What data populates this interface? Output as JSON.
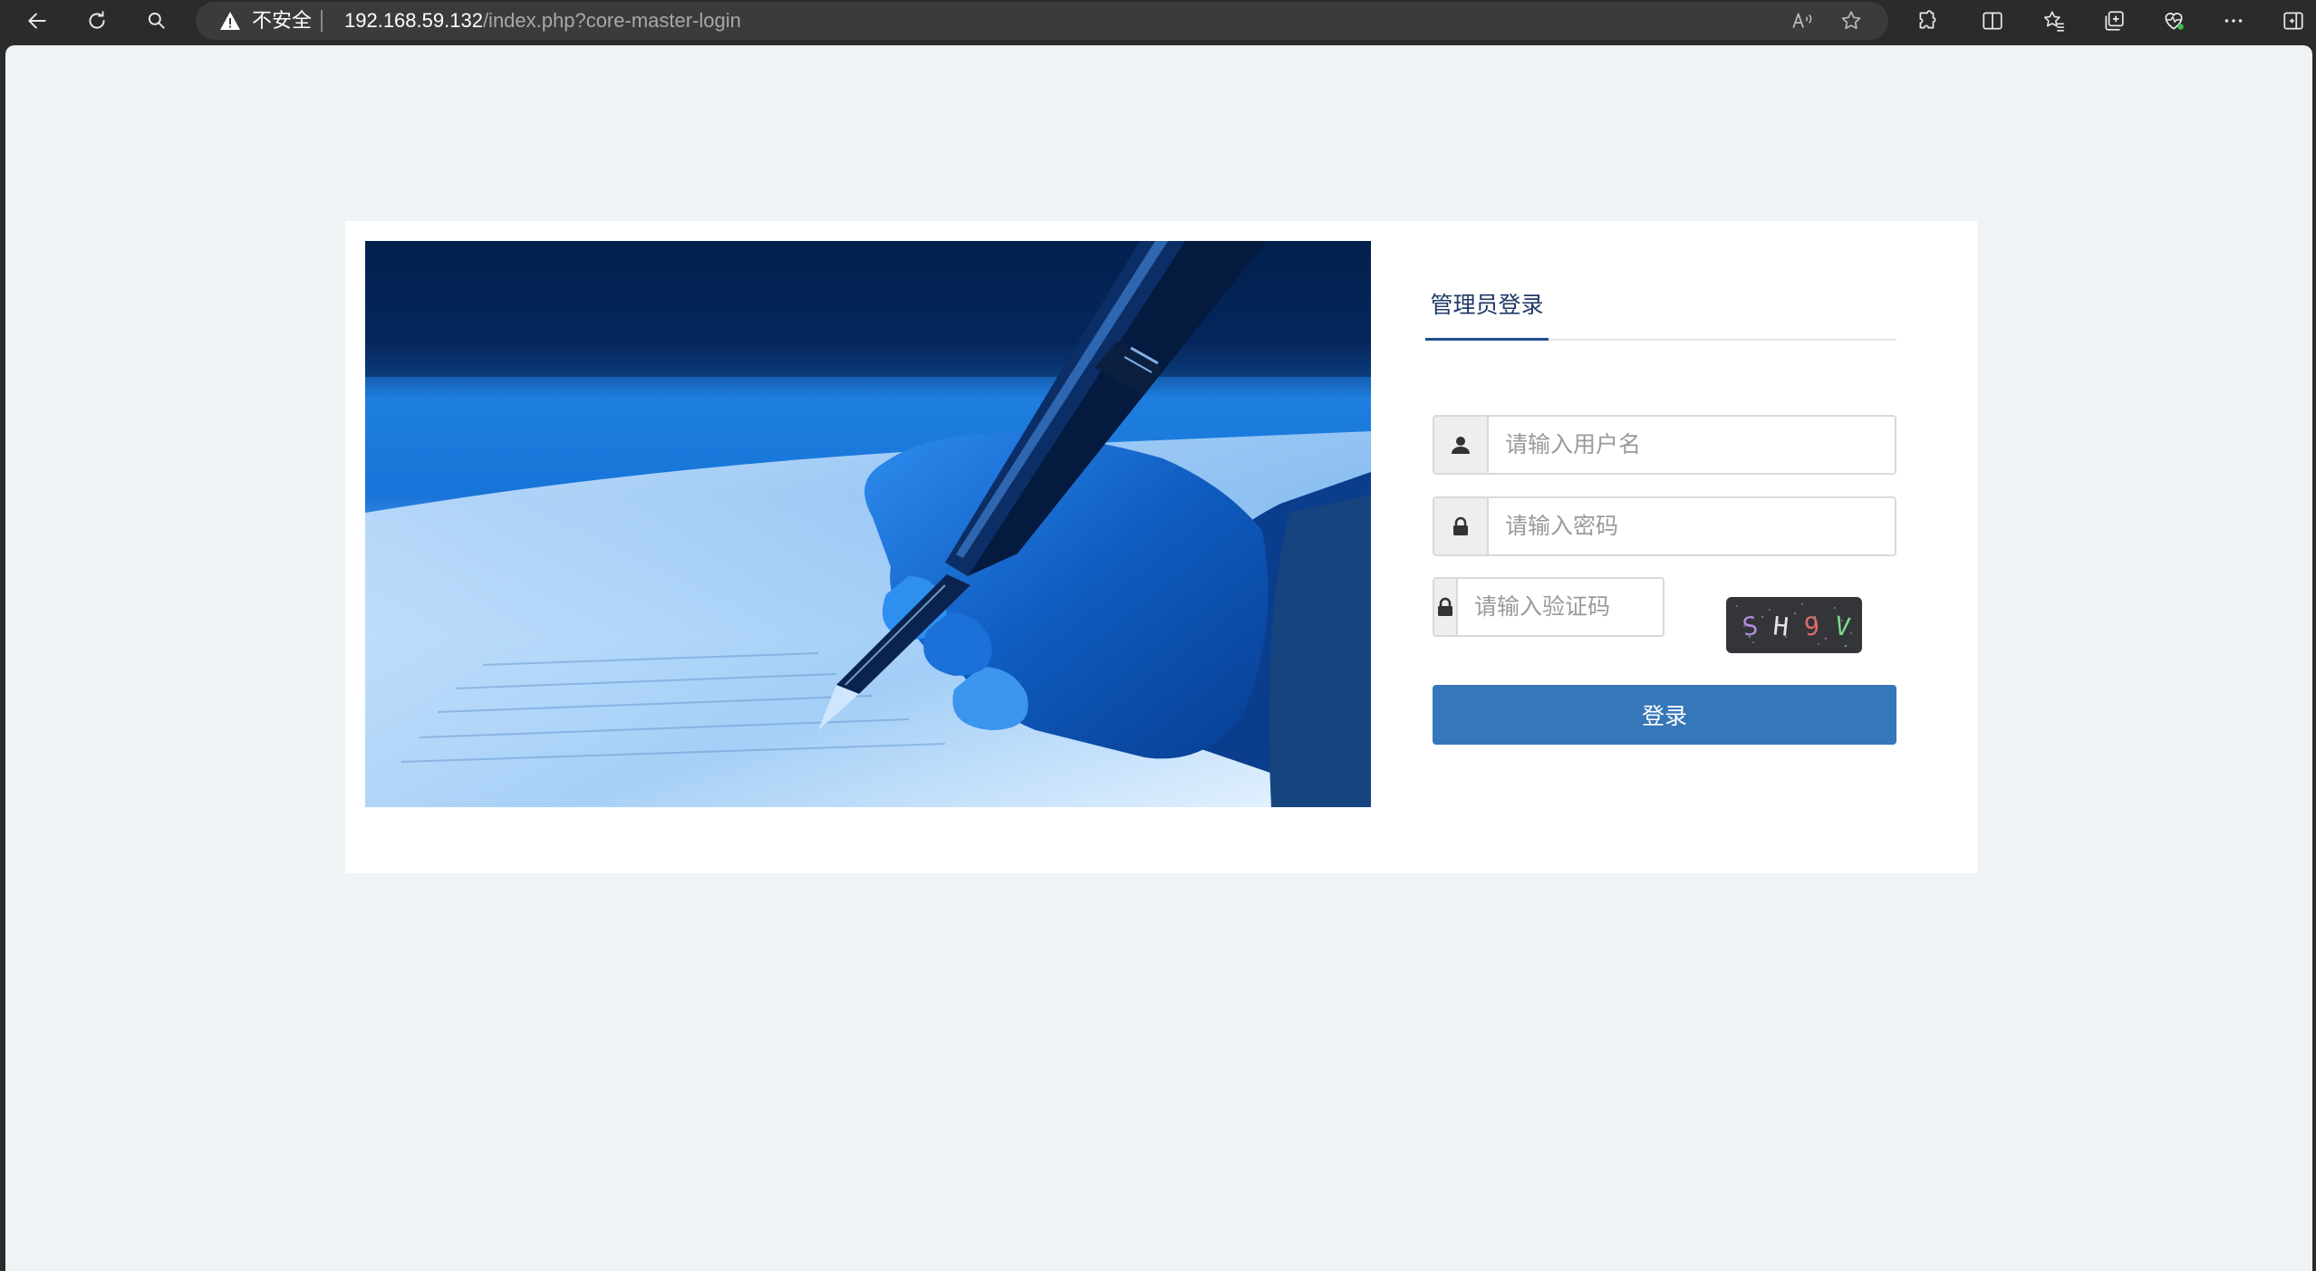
{
  "browser": {
    "security_label": "不安全",
    "url_host": "192.168.59.132",
    "url_path": "/index.php?core-master-login",
    "icons": [
      "back-icon",
      "refresh-icon",
      "search-icon",
      "warning-icon",
      "read-aloud-icon",
      "favorite-icon",
      "extensions-icon",
      "split-screen-icon",
      "favorites-icon",
      "collections-icon",
      "browser-essentials-icon",
      "more-icon",
      "sidebar-icon"
    ]
  },
  "login": {
    "tab_label": "管理员登录",
    "username_placeholder": "请输入用户名",
    "password_placeholder": "请输入密码",
    "captcha_placeholder": "请输入验证码",
    "captcha_text": "SH9V",
    "submit_label": "登录"
  },
  "colors": {
    "page_background": "#eff3f6",
    "card_background": "#ffffff",
    "button_primary": "#3677b9",
    "tab_accent": "#1f4e8c"
  }
}
